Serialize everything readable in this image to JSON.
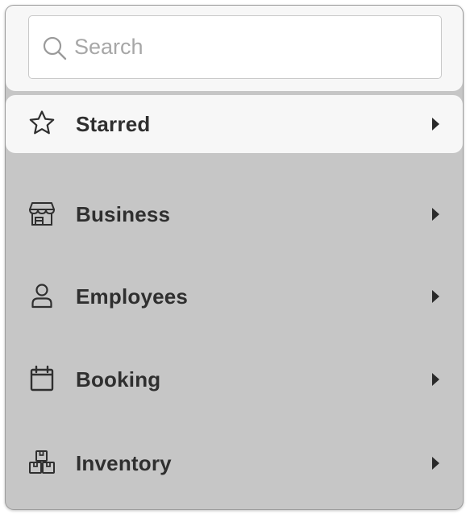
{
  "search": {
    "placeholder": "Search",
    "value": "",
    "icon": "search-icon"
  },
  "menu": {
    "items": [
      {
        "label": "Starred",
        "icon": "star-icon",
        "highlighted": true
      },
      {
        "label": "Business",
        "icon": "storefront-icon",
        "highlighted": false
      },
      {
        "label": "Employees",
        "icon": "person-icon",
        "highlighted": false
      },
      {
        "label": "Booking",
        "icon": "calendar-icon",
        "highlighted": false
      },
      {
        "label": "Inventory",
        "icon": "boxes-icon",
        "highlighted": false
      }
    ]
  },
  "colors": {
    "panel_background": "#c6c6c6",
    "highlight_background": "#f7f7f7",
    "text": "#2f2f2f",
    "placeholder": "#a7a7a7"
  }
}
